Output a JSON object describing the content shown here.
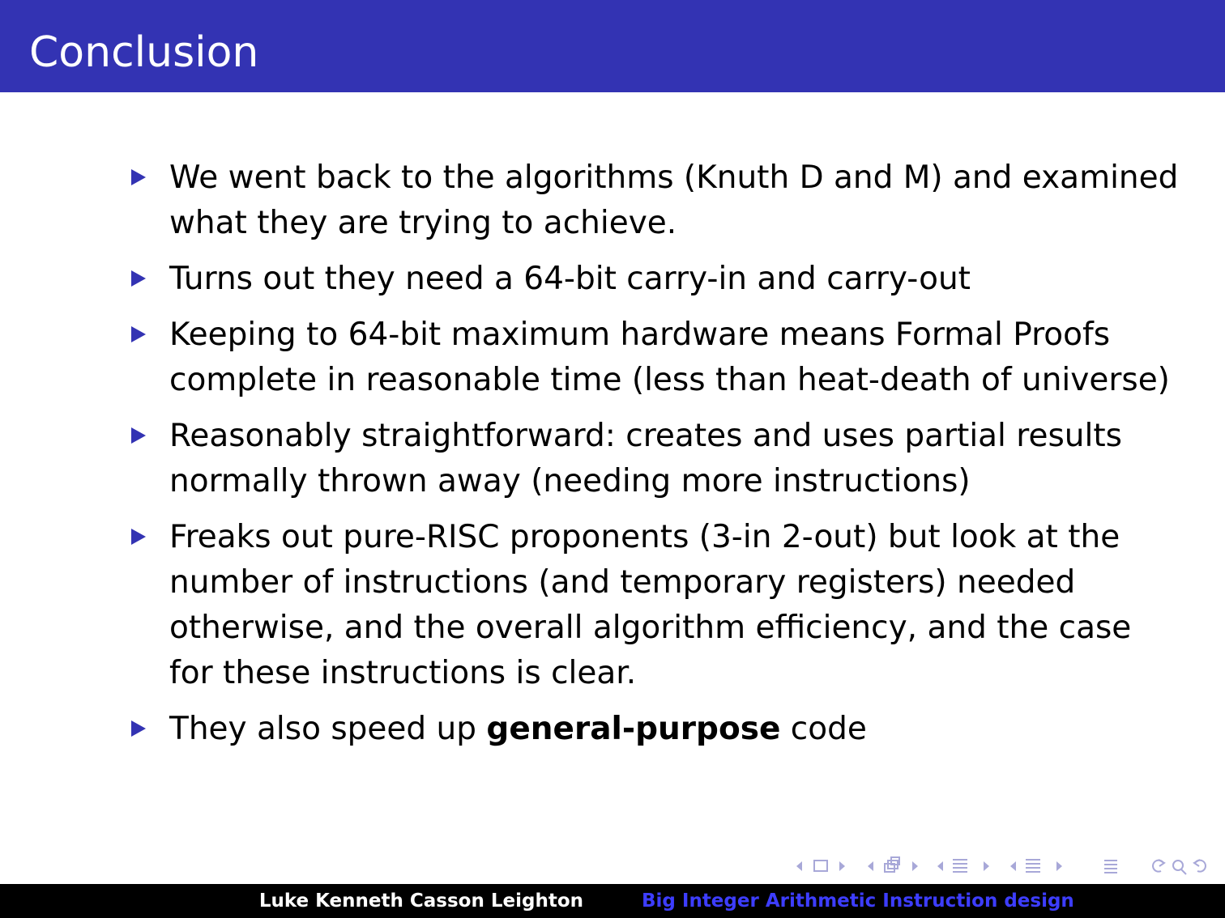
{
  "slide": {
    "title": "Conclusion",
    "bullets": [
      {
        "text": "We went back to the algorithms (Knuth D and M) and examined what they are trying to achieve."
      },
      {
        "text": "Turns out they need a 64-bit carry-in and carry-out"
      },
      {
        "text": "Keeping to 64-bit maximum hardware means Formal Proofs complete in reasonable time (less than heat-death of universe)"
      },
      {
        "text": "Reasonably straightforward: creates and uses partial results normally thrown away (needing more instructions)"
      },
      {
        "text": "Freaks out pure-RISC proponents (3-in 2-out) but look at the number of instructions (and temporary registers) needed otherwise, and the overall algorithm efficiency, and the case for these instructions is clear."
      },
      {
        "before": "They also speed up ",
        "bold": "general-purpose",
        "after": " code"
      }
    ]
  },
  "footer": {
    "author": "Luke Kenneth Casson Leighton",
    "talk_title": "Big Integer Arithmetic Instruction design"
  },
  "colors": {
    "title_bar": "#3333b3",
    "bullet_marker": "#3333b3",
    "footer_left_bg": "#000000",
    "footer_right_bg": "#000000",
    "footer_right_text": "#3d3dff",
    "nav_icons": "#a8a8d8"
  },
  "nav_icons": [
    "arrow-left-icon",
    "frame-icon",
    "arrow-right-icon",
    "arrow-left-icon",
    "subsection-icon",
    "arrow-right-icon",
    "arrow-left-icon",
    "section-icon",
    "arrow-right-icon",
    "arrow-left-icon",
    "section-icon",
    "arrow-right-icon",
    "align-icon",
    "back-icon",
    "search-icon",
    "forward-icon"
  ]
}
